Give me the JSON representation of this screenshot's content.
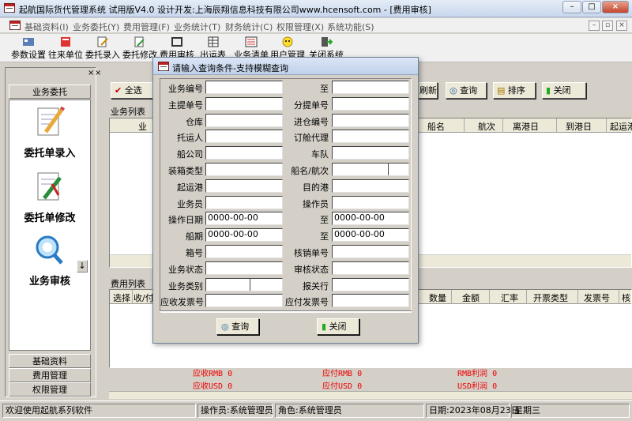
{
  "window": {
    "title": "起航国际货代管理系统 试用版V4.0 设计开发:上海辰翔信息科技有限公司www.hcensoft.com - [费用审核]",
    "minimize": "–",
    "maximize": "□",
    "close": "×"
  },
  "menu": [
    "基础资料(I)",
    "业务委托(Y)",
    "费用管理(F)",
    "业务统计(T)",
    "财务统计(C)",
    "权限管理(X)",
    "系统功能(S)"
  ],
  "mdi": {
    "minimize": "–",
    "restore": "▫",
    "close": "×"
  },
  "toolbar": [
    "参数设置",
    "往来单位",
    "委托录入",
    "委托修改",
    "费用审核",
    "出运表",
    "业务清单",
    "用户管理",
    "关闭系统"
  ],
  "left": {
    "section": "业务委托",
    "items": [
      "委托单录入",
      "委托单修改",
      "业务审核"
    ],
    "tabs": [
      "基础资料",
      "费用管理",
      "权限管理"
    ],
    "close": "×",
    "scroll": "↓"
  },
  "main": {
    "actions": {
      "select_all": "全选",
      "refresh": "刷新",
      "query": "查询",
      "sort": "排序",
      "close": "关闭"
    },
    "panel_close": "×",
    "biz_list": {
      "title": "业务列表",
      "columns": [
        "业",
        "船名",
        "航次",
        "离港日",
        "到港日",
        "起运港"
      ]
    },
    "fee_list": {
      "title": "费用列表",
      "columns": [
        "选择",
        "收/付",
        "数量",
        "金额",
        "汇率",
        "开票类型",
        "发票号",
        "核"
      ]
    },
    "totals": {
      "recv_rmb": "应收RMB 0",
      "recv_usd": "应收USD 0",
      "pay_rmb": "应付RMB 0",
      "pay_usd": "应付USD 0",
      "profit_rmb": "RMB利润 0",
      "profit_usd": "USD利润 0"
    }
  },
  "status": {
    "welcome": "欢迎使用起航系列软件",
    "operator": "操作员:系统管理员",
    "role": "角色:系统管理员",
    "date": "日期:2023年08月23日",
    "weekday": "星期三"
  },
  "dialog": {
    "title": "请输入查询条件-支持模糊查询",
    "fields": [
      {
        "label": "业务编号",
        "value": ""
      },
      {
        "label": "至",
        "value": ""
      },
      {
        "label": "主提单号",
        "value": ""
      },
      {
        "label": "分提单号",
        "value": ""
      },
      {
        "label": "仓库",
        "value": ""
      },
      {
        "label": "进仓编号",
        "value": ""
      },
      {
        "label": "托运人",
        "value": ""
      },
      {
        "label": "订舱代理",
        "value": ""
      },
      {
        "label": "船公司",
        "value": ""
      },
      {
        "label": "车队",
        "value": ""
      },
      {
        "label": "装箱类型",
        "value": ""
      },
      {
        "label": "船名/航次",
        "value": ""
      },
      {
        "label": "起运港",
        "value": ""
      },
      {
        "label": "目的港",
        "value": ""
      },
      {
        "label": "业务员",
        "value": ""
      },
      {
        "label": "操作员",
        "value": ""
      },
      {
        "label": "操作日期",
        "value": "0000-00-00"
      },
      {
        "label": "至",
        "value": "0000-00-00"
      },
      {
        "label": "船期",
        "value": "0000-00-00"
      },
      {
        "label": "至",
        "value": "0000-00-00"
      },
      {
        "label": "箱号",
        "value": ""
      },
      {
        "label": "核销单号",
        "value": ""
      },
      {
        "label": "业务状态",
        "value": ""
      },
      {
        "label": "审核状态",
        "value": ""
      },
      {
        "label": "业务类别",
        "value": ""
      },
      {
        "label": "报关行",
        "value": ""
      },
      {
        "label": "应收发票号",
        "value": ""
      },
      {
        "label": "应付发票号",
        "value": ""
      }
    ],
    "query_button": "查询",
    "close_button": "关闭"
  }
}
